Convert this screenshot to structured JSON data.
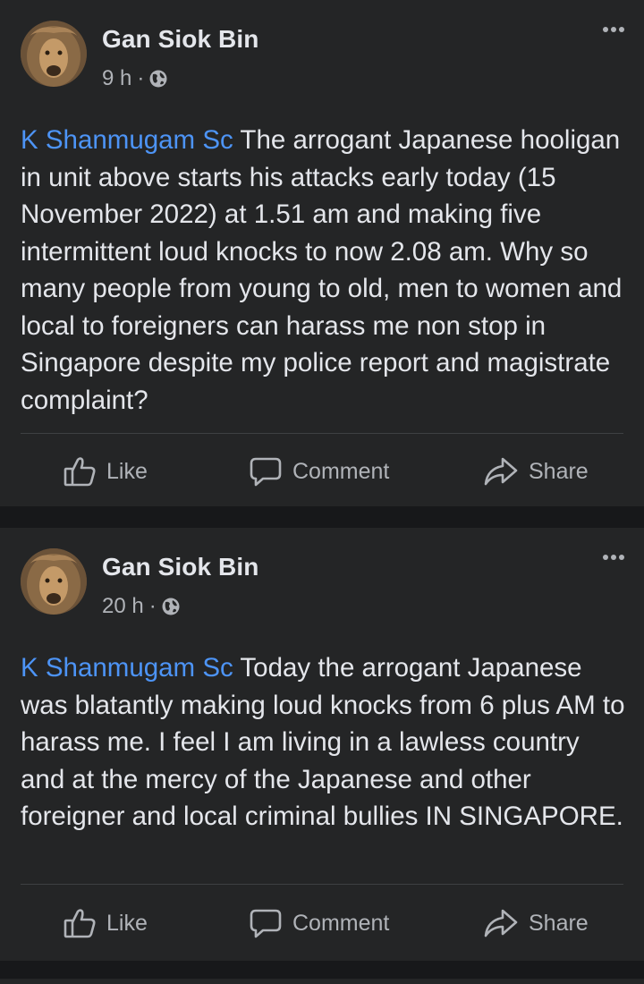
{
  "posts": [
    {
      "author": "Gan Siok Bin",
      "time": "9 h",
      "separator": "·",
      "mention": "K Shanmugam Sc",
      "text": " The arrogant Japanese hooligan in unit above starts his attacks early today (15 November 2022) at 1.51 am and making five intermittent loud knocks to now 2.08 am. Why so many people from young to old, men to women and local to foreigners can harass me non stop in Singapore despite my police report and magistrate complaint?",
      "actions": {
        "like": "Like",
        "comment": "Comment",
        "share": "Share"
      }
    },
    {
      "author": "Gan Siok Bin",
      "time": "20 h",
      "separator": "·",
      "mention": "K Shanmugam Sc",
      "text": " Today the arrogant Japanese was blatantly making loud knocks from 6 plus AM to harass me. I feel I am living in a lawless country and at the mercy of the Japanese and other foreigner and local criminal bullies IN SINGAPORE.",
      "actions": {
        "like": "Like",
        "comment": "Comment",
        "share": "Share"
      }
    }
  ],
  "icons": {
    "privacy": "globe-icon",
    "menu": "more-horizontal-icon",
    "like": "thumbs-up-icon",
    "comment": "speech-bubble-icon",
    "share": "share-arrow-icon"
  },
  "colors": {
    "background": "#17181a",
    "card": "#242526",
    "text_primary": "#e4e6eb",
    "text_secondary": "#b0b3b8",
    "mention": "#4d94f6",
    "divider": "#3e4042"
  }
}
